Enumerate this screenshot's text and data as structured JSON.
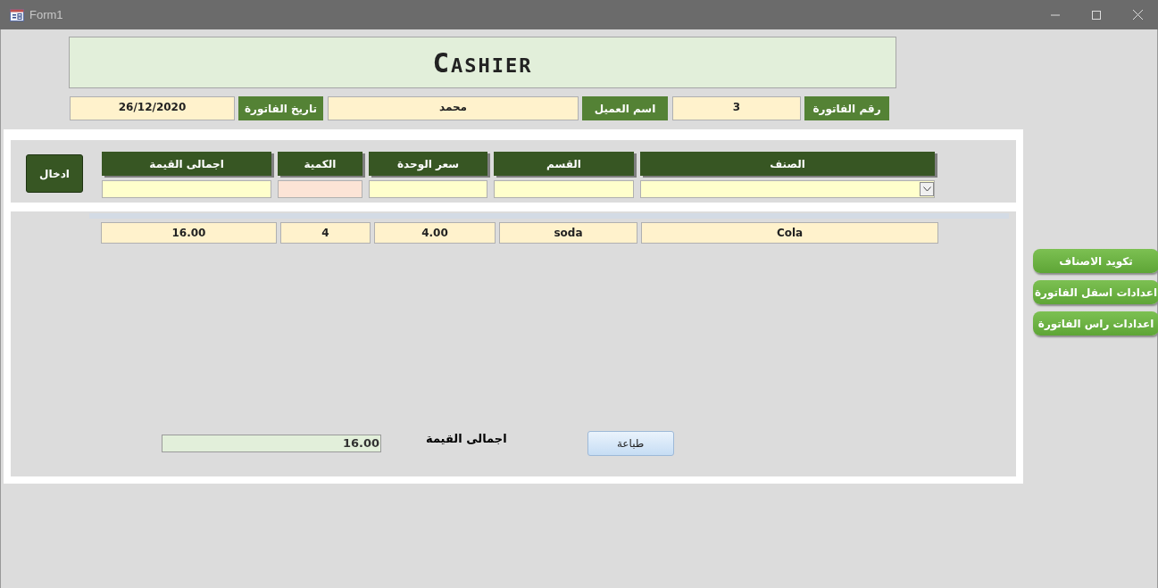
{
  "window": {
    "title": "Form1"
  },
  "header": {
    "title": "Cashier"
  },
  "invoice_fields": [
    {
      "label": "رقم الفاتورة",
      "value": "3"
    },
    {
      "label": "اسم العميل",
      "value": "محمد"
    },
    {
      "label": "تاريخ الفاتورة",
      "value": "26/12/2020"
    }
  ],
  "entry": {
    "columns": [
      {
        "heading": "الصنف",
        "kind": "combo"
      },
      {
        "heading": "القسم",
        "kind": "text"
      },
      {
        "heading": "سعر الوحدة",
        "kind": "text"
      },
      {
        "heading": "الكمية",
        "kind": "accent"
      },
      {
        "heading": "اجمالى القيمة",
        "kind": "text"
      }
    ],
    "button": "ادخال"
  },
  "rows": [
    {
      "cells": [
        "Cola",
        "soda",
        "4.00",
        "4",
        "16.00"
      ]
    }
  ],
  "total": {
    "label": "اجمالى القيمة",
    "value": "16.00"
  },
  "print_button": "طباعة",
  "side_buttons": [
    "تكويد الاصناف",
    "اعدادات اسفل الفاتورة",
    "اعدادات راس الفاتورة"
  ]
}
